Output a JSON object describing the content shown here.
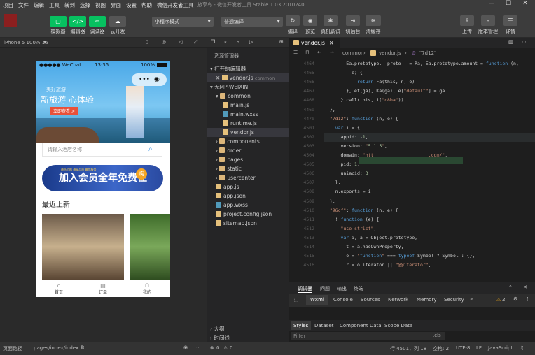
{
  "menubar": {
    "items": [
      "项目",
      "文件",
      "编辑",
      "工具",
      "转到",
      "选择",
      "视图",
      "界面",
      "设置",
      "帮助",
      "微信开发者工具"
    ],
    "title": "旅享岛 - 微信开发者工具 Stable 1.03.2010240"
  },
  "toolbar": {
    "simulator": "模拟器",
    "editor": "编辑器",
    "debugger": "调试器",
    "cloud": "云开发",
    "mode": "小程序模式",
    "compile_mode": "普通编译",
    "compile": "编译",
    "preview": "预览",
    "remote_debug": "真机调试",
    "background": "切后台",
    "clear_cache": "清缓存",
    "upload": "上传",
    "version": "版本管理",
    "details": "详情",
    "colors": {
      "green": "#07c160",
      "red": "#a52a2a"
    }
  },
  "simulator": {
    "device": "iPhone 5 100% 16",
    "status": {
      "carrier": "●●●●● WeChat",
      "wifi": "WiFi",
      "time": "13:35",
      "battery": "100%"
    },
    "banner_small": "美好旅游",
    "banner_title": "新旅游 心体验",
    "banner_button": "立即查看 >",
    "search_placeholder": "请输入酒店名称",
    "vip_text": "加入会员全年免费住",
    "vip_badge": "购",
    "vip_small": "最低价格 最高品质 最优服务",
    "recent": "最近上新",
    "tabs": [
      "首页",
      "订单",
      "我的"
    ]
  },
  "simfoot": {
    "path_label": "页面路径",
    "path": "pages/index/index"
  },
  "explorer": {
    "header": "资源管理器",
    "open_editors": "打开的编辑器",
    "open_file": "vendor.js",
    "open_file_dir": "common",
    "project": "无MP-WEIXIN",
    "tree": [
      {
        "name": "common",
        "type": "folder",
        "depth": 1,
        "open": true
      },
      {
        "name": "main.js",
        "type": "js",
        "depth": 2
      },
      {
        "name": "main.wxss",
        "type": "wxss",
        "depth": 2
      },
      {
        "name": "runtime.js",
        "type": "js",
        "depth": 2
      },
      {
        "name": "vendor.js",
        "type": "js",
        "depth": 2,
        "selected": true
      },
      {
        "name": "components",
        "type": "folder",
        "depth": 1
      },
      {
        "name": "order",
        "type": "folder",
        "depth": 1
      },
      {
        "name": "pages",
        "type": "folder",
        "depth": 1
      },
      {
        "name": "static",
        "type": "folder",
        "depth": 1
      },
      {
        "name": "usercenter",
        "type": "folder",
        "depth": 1
      },
      {
        "name": "app.js",
        "type": "js",
        "depth": 1
      },
      {
        "name": "app.json",
        "type": "json",
        "depth": 1
      },
      {
        "name": "app.wxss",
        "type": "wxss",
        "depth": 1
      },
      {
        "name": "project.config.json",
        "type": "json",
        "depth": 1
      },
      {
        "name": "sitemap.json",
        "type": "json",
        "depth": 1
      }
    ],
    "outline": "大纲",
    "timeline": "时间线"
  },
  "editor": {
    "tab": "vendor.js",
    "breadcrumb": [
      "common",
      "vendor.js",
      "\"7d12\""
    ],
    "lines": [
      {
        "n": "4464",
        "t": "        Ea.prototype.__proto__ = Ra, Ea.prototype.amount = function (n,"
      },
      {
        "n": "4465",
        "t": "          e) {"
      },
      {
        "n": "4466",
        "t": "            return Fa(this, n, e)"
      },
      {
        "n": "4467",
        "t": "        }, et(ga), Ka(ga), e[\"default\"] = ga"
      },
      {
        "n": "4468",
        "t": "      }.call(this, i(\"c8ba\"))"
      },
      {
        "n": "4469",
        "t": "  },"
      },
      {
        "n": "4470",
        "t": "  \"7d12\": function (n, e) {"
      },
      {
        "n": "4501",
        "t": "    var i = {"
      },
      {
        "n": "4502",
        "t": "      appid: -1,"
      },
      {
        "n": "4503",
        "t": "      version: \"5.1.5\","
      },
      {
        "n": "4504",
        "t": "      domain: \"htt                    .com/\","
      },
      {
        "n": "4505",
        "t": "      pid: 1,"
      },
      {
        "n": "4506",
        "t": "      uniacid: 3"
      },
      {
        "n": "4507",
        "t": "    };"
      },
      {
        "n": "4508",
        "t": "    n.exports = i"
      },
      {
        "n": "4509",
        "t": "  },"
      },
      {
        "n": "4510",
        "t": "  \"96cf\": function (n, e) {"
      },
      {
        "n": "4511",
        "t": "    ! function (e) {"
      },
      {
        "n": "4512",
        "t": "      \"use strict\";"
      },
      {
        "n": "4513",
        "t": "      var i, a = Object.prototype,"
      },
      {
        "n": "4514",
        "t": "        t = a.hasOwnProperty,"
      },
      {
        "n": "4515",
        "t": "        o = \"function\" === typeof Symbol ? Symbol : {},"
      },
      {
        "n": "4516",
        "t": "        r = o.iterator || \"@@iterator\","
      }
    ]
  },
  "devtools": {
    "top_tabs": [
      "调试器",
      "问题",
      "输出",
      "终端"
    ],
    "tabs": [
      "Wxml",
      "Console",
      "Sources",
      "Network",
      "Memory",
      "Security"
    ],
    "warn": "2",
    "sub_tabs": [
      "Styles",
      "Dataset",
      "Component Data",
      "Scope Data"
    ],
    "filter": "Filter",
    "cls": ".cls"
  },
  "statusbar": {
    "errors": "0",
    "warnings": "0",
    "position": "行 4501，列 18",
    "spaces": "空格: 2",
    "encoding": "UTF-8",
    "eol": "LF",
    "language": "JavaScript"
  }
}
